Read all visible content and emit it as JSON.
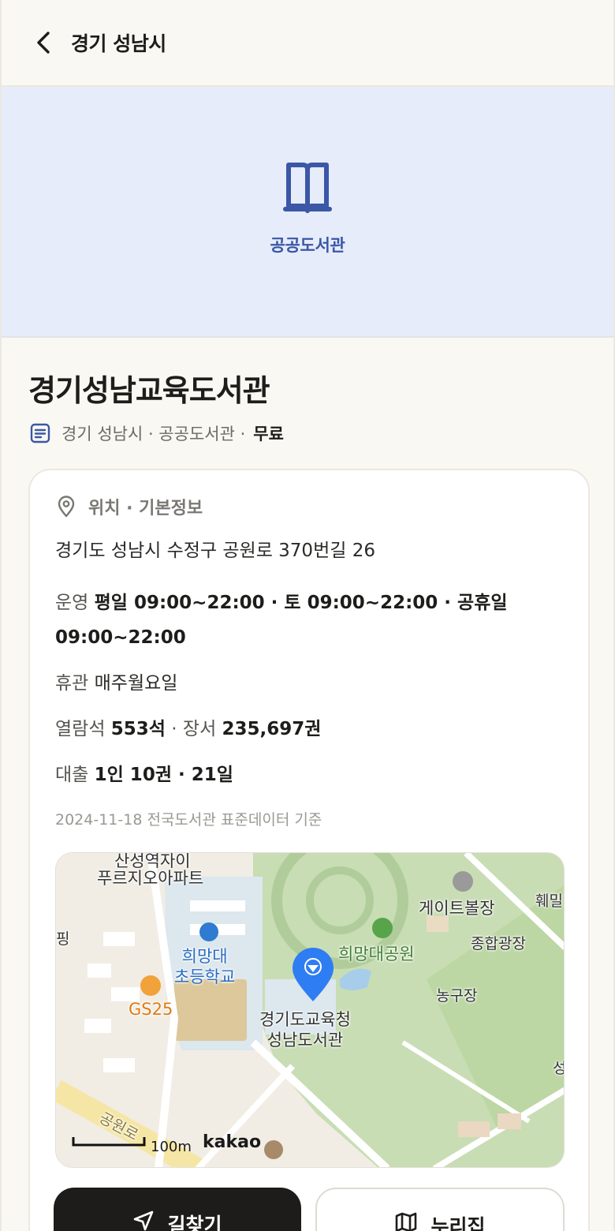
{
  "header": {
    "title": "경기 성남시"
  },
  "hero": {
    "label": "공공도서관"
  },
  "library": {
    "name": "경기성남교육도서관",
    "meta_region": "경기 성남시 · 공공도서관 ·",
    "meta_fee": "무료"
  },
  "info": {
    "section_title": "위치 · 기본정보",
    "address": "경기도 성남시 수정구 공원로 370번길 26",
    "hours_label": "운영",
    "hours_value": "평일 09:00~22:00 · 토 09:00~22:00 · 공휴일 09:00~22:00",
    "closed_label": "휴관",
    "closed_value": "매주월요일",
    "seats_label": "열람석",
    "seats_value": "553석",
    "books_label": "· 장서",
    "books_value": "235,697권",
    "loan_label": "대출",
    "loan_value": "1인 10권 · 21일",
    "source": "2024-11-18 전국도서관 표준데이터 기준"
  },
  "map": {
    "labels": {
      "apt_top": "산성역자이",
      "apt": "푸르지오아파트",
      "school": "희망대\n초등학교",
      "gs25": "GS25",
      "park": "희망대공원",
      "gate": "게이트볼장",
      "plaza": "종합광장",
      "court": "농구장",
      "library": "경기도교육청\n성남도서관",
      "edge_right": "훼밀",
      "edge_left": "핑",
      "edge_right2": "성",
      "road": "공원로",
      "scale": "100m",
      "brand": "kakao"
    }
  },
  "actions": {
    "directions": "길찾기",
    "site": "누리집"
  }
}
